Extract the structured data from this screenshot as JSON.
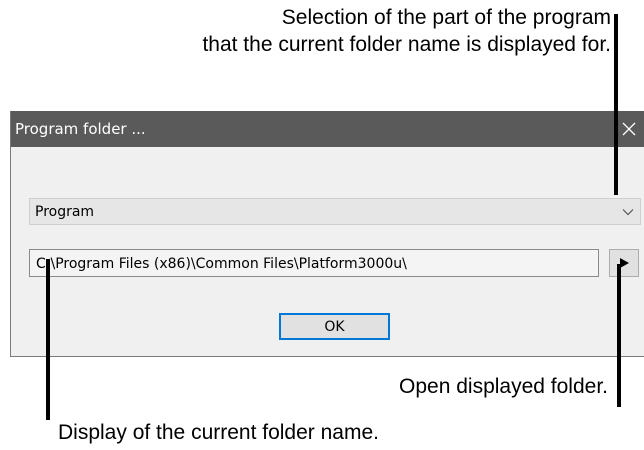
{
  "annotations": {
    "selection_line1": "Selection of the part of the program",
    "selection_line2": "that the current folder name is displayed for.",
    "open_folder": "Open displayed folder.",
    "display_folder": "Display of the current folder name."
  },
  "dialog": {
    "title": "Program folder ...",
    "program_select": {
      "selected": "Program"
    },
    "folder_path": "C:\\Program Files (x86)\\Common Files\\Platform3000u\\",
    "ok_label": "OK"
  },
  "icons": {
    "close": "close-icon",
    "dropdown": "chevron-down-icon",
    "open": "play-arrow-icon"
  },
  "colors": {
    "titlebar": "#5a5a5a",
    "dialog_bg": "#f0f0f0",
    "ok_border": "#0078d7"
  }
}
